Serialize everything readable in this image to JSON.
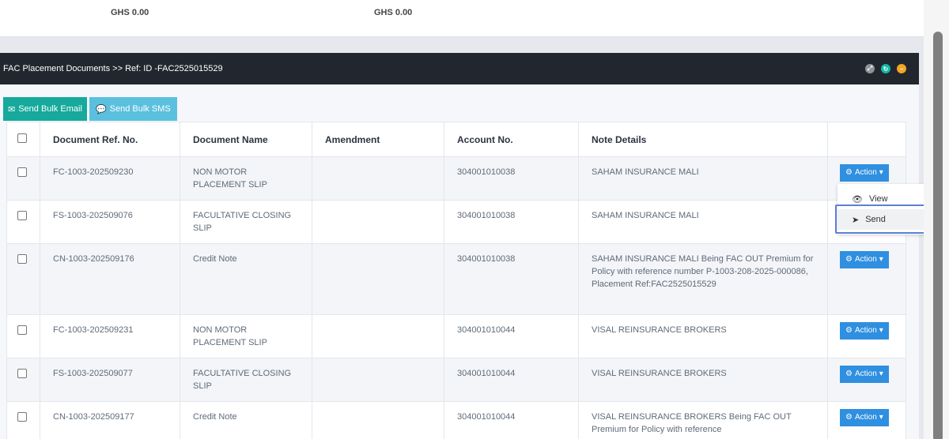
{
  "summary": {
    "amount1": "GHS 0.00",
    "amount2": "GHS 0.00"
  },
  "panel": {
    "title": "FAC Placement Documents >> Ref: ID -FAC2525015529",
    "header_icons": [
      "expand-icon",
      "refresh-icon",
      "minimize-icon"
    ]
  },
  "toolbar": {
    "email_label": "Send Bulk Email",
    "sms_label": "Send Bulk SMS"
  },
  "table": {
    "headers": [
      "Document Ref. No.",
      "Document Name",
      "Amendment",
      "Account No.",
      "Note Details"
    ],
    "action_label": "Action",
    "rows": [
      {
        "ref": "FC-1003-202509230",
        "name": "NON MOTOR PLACEMENT SLIP",
        "amendment": "",
        "account": "304001010038",
        "note": "SAHAM INSURANCE MALI"
      },
      {
        "ref": "FS-1003-202509076",
        "name": "FACULTATIVE CLOSING SLIP",
        "amendment": "",
        "account": "304001010038",
        "note": "SAHAM INSURANCE MALI"
      },
      {
        "ref": "CN-1003-202509176",
        "name": "Credit Note",
        "amendment": "",
        "account": "304001010038",
        "note": "SAHAM INSURANCE MALI Being FAC OUT Premium for Policy with reference number P-1003-208-2025-000086, Placement Ref:FAC2525015529"
      },
      {
        "ref": "FC-1003-202509231",
        "name": "NON MOTOR PLACEMENT SLIP",
        "amendment": "",
        "account": "304001010044",
        "note": "VISAL REINSURANCE BROKERS"
      },
      {
        "ref": "FS-1003-202509077",
        "name": "FACULTATIVE CLOSING SLIP",
        "amendment": "",
        "account": "304001010044",
        "note": "VISAL REINSURANCE BROKERS"
      },
      {
        "ref": "CN-1003-202509177",
        "name": "Credit Note",
        "amendment": "",
        "account": "304001010044",
        "note": "VISAL REINSURANCE BROKERS Being FAC OUT Premium for Policy with reference"
      }
    ]
  },
  "dropdown": {
    "view_label": "View",
    "send_label": "Send"
  },
  "colors": {
    "header_bg": "#22272f",
    "email_btn": "#16a99c",
    "sms_btn": "#5bc0de",
    "action_btn": "#2f8fe0",
    "highlight": "#5b7fd8"
  }
}
